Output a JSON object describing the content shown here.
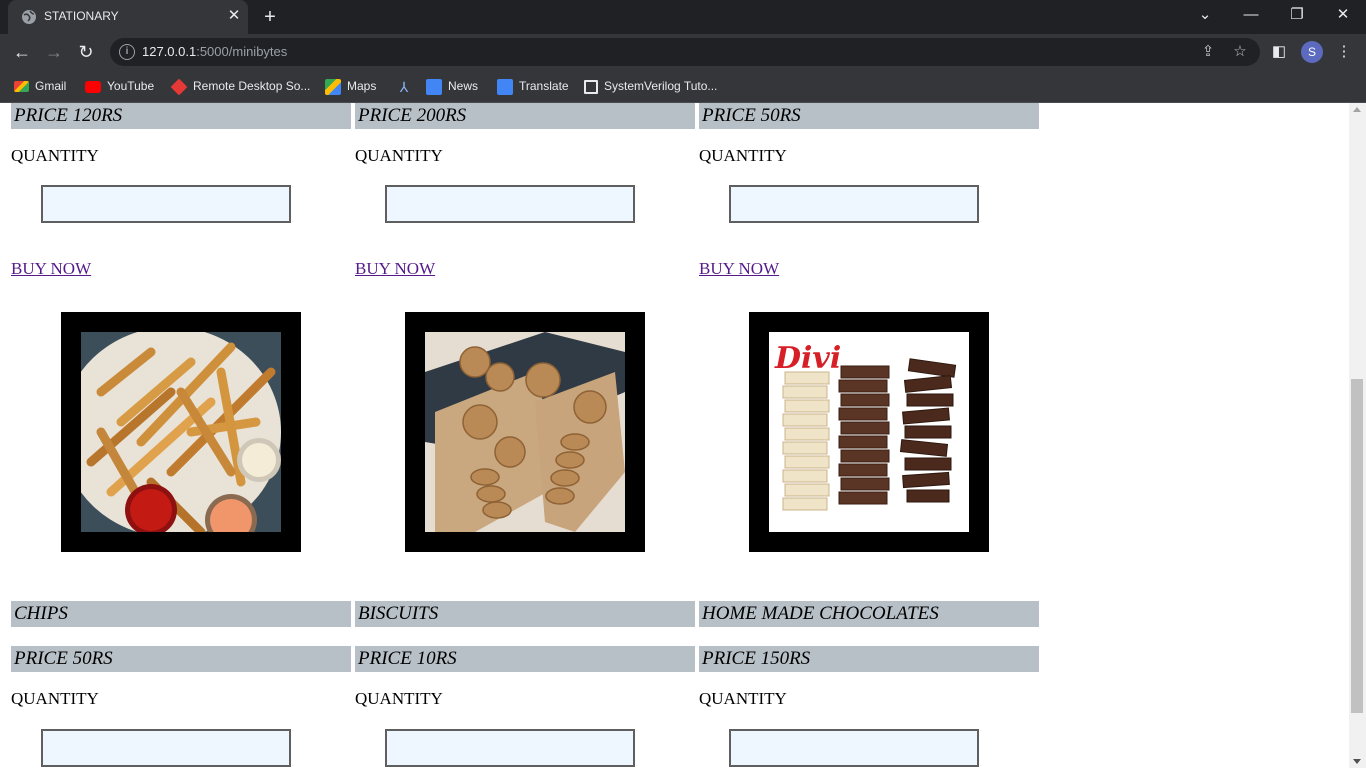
{
  "browser": {
    "tab_title": "STATIONARY",
    "url_host": "127.0.0.1",
    "url_path": ":5000/minibytes",
    "avatar_letter": "S",
    "bookmarks": [
      {
        "label": "Gmail",
        "icon": "gmail-icon"
      },
      {
        "label": "YouTube",
        "icon": "youtube-icon"
      },
      {
        "label": "Remote Desktop So...",
        "icon": "remote-desktop-icon"
      },
      {
        "label": "Maps",
        "icon": "maps-icon"
      },
      {
        "label": "",
        "icon": "bookmark-app-icon"
      },
      {
        "label": "News",
        "icon": "news-icon"
      },
      {
        "label": "Translate",
        "icon": "translate-icon"
      },
      {
        "label": "SystemVerilog Tuto...",
        "icon": "chip-icon"
      }
    ]
  },
  "rows": [
    {
      "items": [
        {
          "price": "PRICE 120RS",
          "quantity_label": "QUANTITY",
          "buy_label": "BUY NOW"
        },
        {
          "price": "PRICE 200RS",
          "quantity_label": "QUANTITY",
          "buy_label": "BUY NOW"
        },
        {
          "price": "PRICE 50RS",
          "quantity_label": "QUANTITY",
          "buy_label": "BUY NOW"
        }
      ]
    },
    {
      "items": [
        {
          "name": "CHIPS",
          "price": "PRICE 50RS",
          "quantity_label": "QUANTITY",
          "image": "fries-image"
        },
        {
          "name": "BISCUITS",
          "price": "PRICE 10RS",
          "quantity_label": "QUANTITY",
          "image": "cookies-image"
        },
        {
          "name": "HOME MADE CHOCOLATES",
          "price": "PRICE 150RS",
          "quantity_label": "QUANTITY",
          "image": "chocolates-image",
          "image_logo_text": "Divi"
        }
      ]
    }
  ],
  "colors": {
    "label_bar": "#b7c0c7",
    "input_bg": "#eef6ff",
    "link": "#551a8b"
  }
}
